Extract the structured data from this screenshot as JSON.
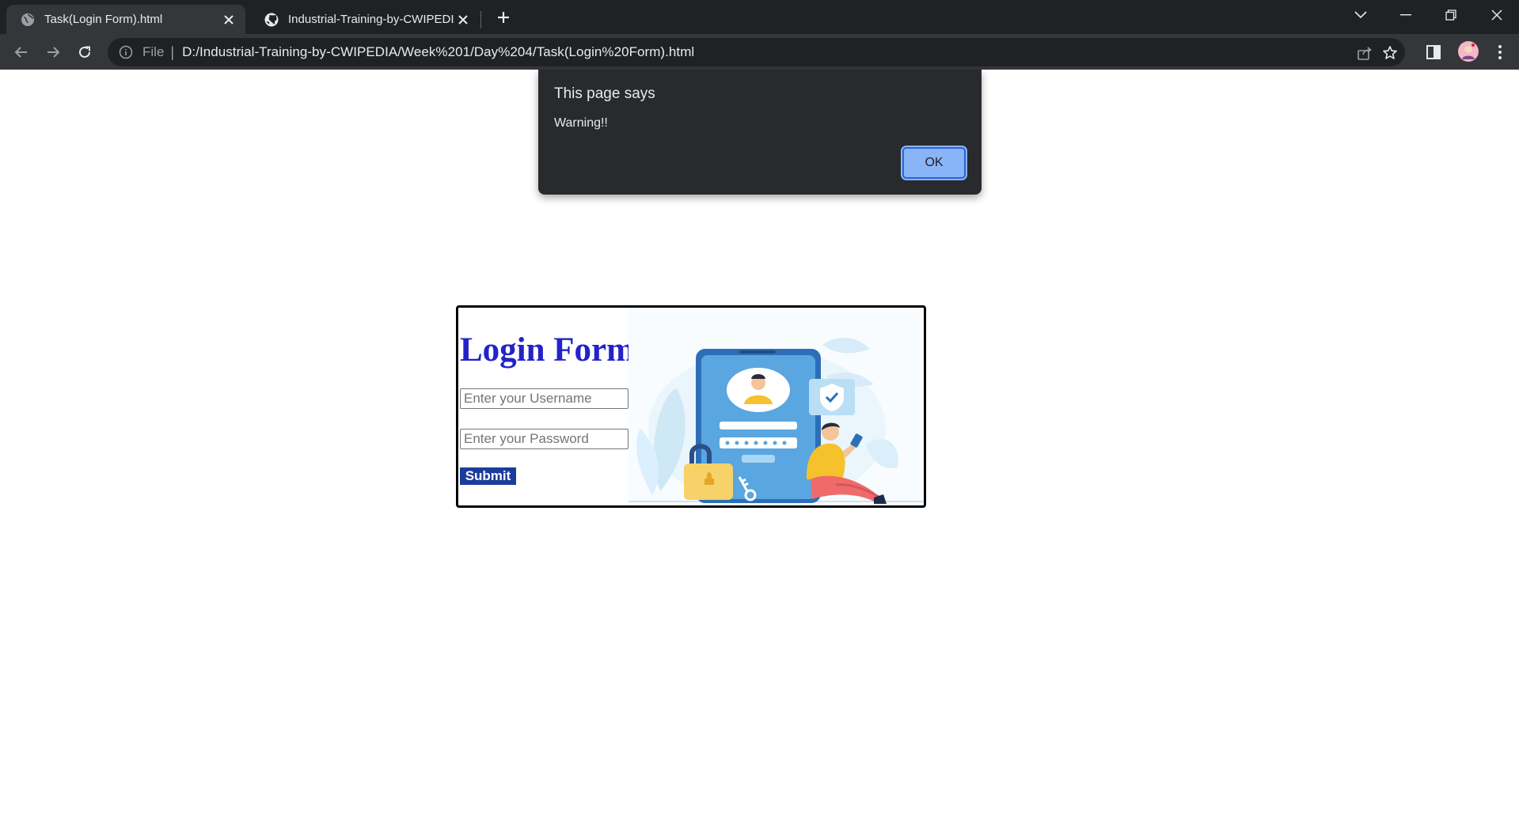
{
  "browser": {
    "tabs": [
      {
        "title": "Task(Login Form).html",
        "icon": "globe-icon",
        "active": true
      },
      {
        "title": "Industrial-Training-by-CWIPEDIA/",
        "icon": "github-icon",
        "active": false
      }
    ],
    "address_bar": {
      "scheme_label": "File",
      "url": "D:/Industrial-Training-by-CWIPEDIA/Week%201/Day%204/Task(Login%20Form).html"
    }
  },
  "dialog": {
    "title": "This page says",
    "message": "Warning!!",
    "ok_label": "OK"
  },
  "login_form": {
    "heading": "Login Form",
    "username_placeholder": "Enter your Username",
    "password_placeholder": "Enter your Password",
    "submit_label": "Submit"
  },
  "colors": {
    "heading": "#2323c8",
    "submit_bg": "#1c3c9c",
    "dialog_button": "#8ab4f8"
  }
}
